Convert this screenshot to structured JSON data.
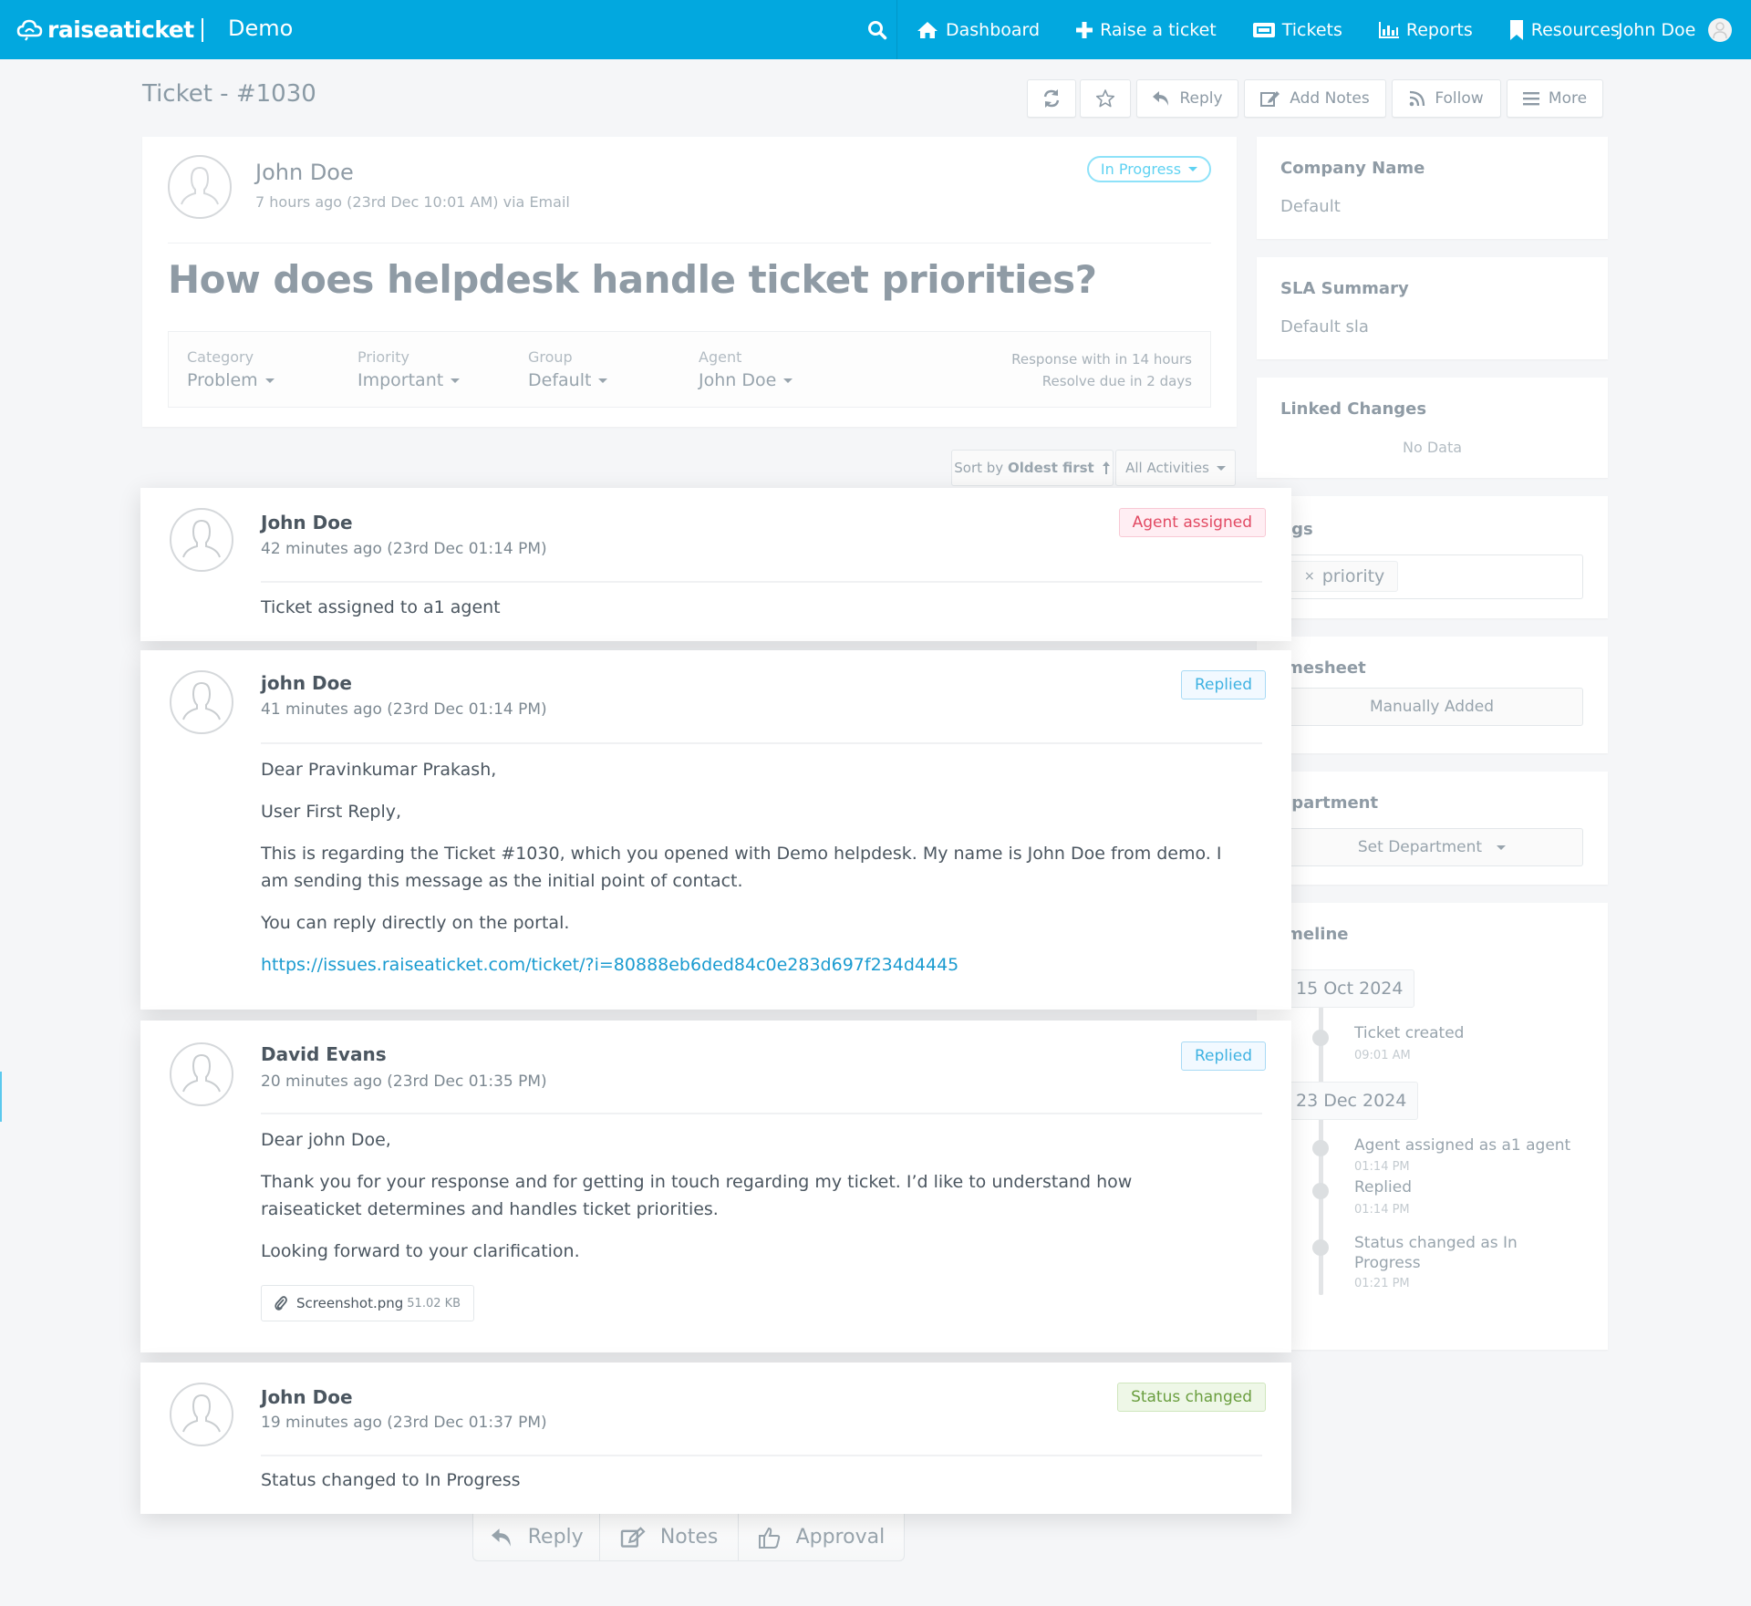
{
  "nav": {
    "brand": "raiseaticket",
    "workspace": "Demo",
    "items": [
      {
        "label": "Dashboard",
        "icon": "home-icon"
      },
      {
        "label": "Raise a ticket",
        "icon": "plus-icon"
      },
      {
        "label": "Tickets",
        "icon": "ticket-icon"
      },
      {
        "label": "Reports",
        "icon": "bar-chart-icon"
      },
      {
        "label": "Resources",
        "icon": "bookmark-icon"
      }
    ],
    "user": "John Doe"
  },
  "header": {
    "title": "Ticket - #1030",
    "toolbar": {
      "refresh_icon": "refresh-icon",
      "star_icon": "star-icon",
      "reply": "Reply",
      "add_notes": "Add Notes",
      "follow": "Follow",
      "more": "More"
    }
  },
  "ticket": {
    "requester": "John Doe",
    "created": "7 hours ago (23rd Dec 10:01 AM) via Email",
    "status": "In Progress",
    "subject": "How does helpdesk handle ticket priorities?",
    "properties": [
      {
        "label": "Category",
        "value": "Problem"
      },
      {
        "label": "Priority",
        "value": "Important"
      },
      {
        "label": "Group",
        "value": "Default"
      },
      {
        "label": "Agent",
        "value": "John Doe"
      }
    ],
    "sla": {
      "response": "Response with in 14 hours",
      "resolve": "Resolve due in 2 days"
    }
  },
  "sort": {
    "prefix": "Sort by",
    "value": "Oldest first",
    "filter": "All Activities"
  },
  "activities": [
    {
      "author": "John Doe",
      "time": "42 minutes ago (23rd Dec 01:14 PM)",
      "badge": "Agent assigned",
      "body": [
        "Ticket assigned to a1 agent"
      ]
    },
    {
      "author": "john Doe",
      "time": "41 minutes ago (23rd Dec 01:14 PM)",
      "badge": "Replied",
      "body": [
        "Dear Pravinkumar Prakash,",
        "User First Reply,",
        "This is regarding the Ticket #1030, which you opened with Demo helpdesk. My name is John Doe from demo. I am sending this message as the initial point of contact.",
        "You can reply directly on the portal."
      ],
      "link": "https://issues.raiseaticket.com/ticket/?i=80888eb6ded84c0e283d697f234d4445"
    },
    {
      "author": "David Evans",
      "time": "20 minutes ago (23rd Dec 01:35 PM)",
      "badge": "Replied",
      "body": [
        "Dear john Doe,",
        "Thank you for your response and for getting in touch regarding my ticket. I’d like to understand how raiseaticket determines and handles ticket priorities.",
        "Looking forward to your clarification."
      ],
      "attachment": {
        "name": "Screenshot.png",
        "size": "51.02 KB"
      }
    },
    {
      "author": "John Doe",
      "time": "19 minutes ago (23rd Dec 01:37 PM)",
      "badge": "Status changed",
      "body": [
        "Status changed to In Progress"
      ]
    }
  ],
  "bottom_actions": [
    "Reply",
    "Notes",
    "Approval"
  ],
  "sidebar": {
    "company": {
      "title": "Company Name",
      "value": "Default"
    },
    "sla_summary": {
      "title": "SLA Summary",
      "value": "Default sla"
    },
    "linked_changes": {
      "title": "Linked Changes",
      "empty": "No Data"
    },
    "tags": {
      "title": "Tags",
      "title_visible": "ags",
      "items": [
        "priority"
      ]
    },
    "timesheet": {
      "title": "Timesheet",
      "title_visible": "imesheet",
      "button": "Manually Added"
    },
    "department": {
      "title": "Department",
      "title_visible": "epartment",
      "placeholder": "Set Department"
    },
    "timeline": {
      "title": "Timeline",
      "title_visible": "imeline",
      "groups": [
        {
          "date": "15 Oct 2024",
          "events": [
            {
              "text": "Ticket created",
              "time": "09:01 AM"
            }
          ]
        },
        {
          "date": "23 Dec 2024",
          "events": [
            {
              "text": "Agent assigned as a1 agent",
              "time": "01:14 PM"
            },
            {
              "text": "Replied",
              "time": "01:14 PM"
            },
            {
              "text": "Status changed as In Progress",
              "time": "01:21 PM"
            }
          ]
        }
      ]
    }
  },
  "colors": {
    "brand": "#02a8df",
    "link": "#1a9bd0",
    "badge_red": "#e24a63",
    "badge_blue": "#3fb2e2",
    "badge_green": "#6a9e3f",
    "status_pill": "#5fd2f2"
  }
}
